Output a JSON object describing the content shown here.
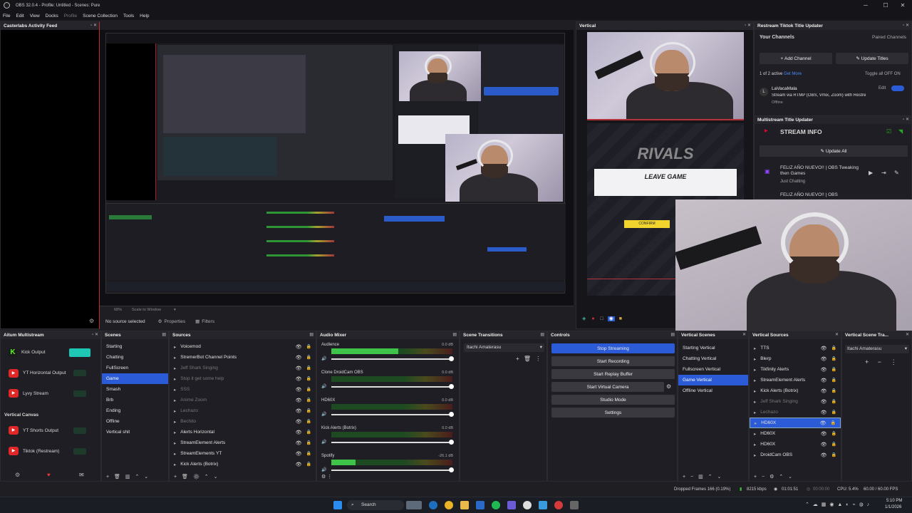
{
  "window": {
    "title": "OBS 32.0.4 - Profile: Untitled - Scenes: Pure"
  },
  "menu": [
    "File",
    "Edit",
    "View",
    "Docks",
    "Profile",
    "Scene Collection",
    "Tools",
    "Help"
  ],
  "activity_feed": {
    "title": "Casterlabs Activity Feed"
  },
  "preview": {
    "zoom": "68%",
    "scale_label": "Scale to Window",
    "no_source": "No source selected",
    "properties": "Properties",
    "filters": "Filters"
  },
  "vertical": {
    "title": "Vertical",
    "game_title": "LEAVE GAME",
    "confirm": "CONFIRM"
  },
  "restream": {
    "title": "Restream Tiktok Title Updater",
    "your_channels": "Your Channels",
    "paired": "Paired Channels",
    "add_channel": "Add Channel",
    "update_titles": "Update Titles",
    "active": "1 of 2 active",
    "get_more": "Get More",
    "toggle_all": "Toggle all",
    "off": "OFF",
    "on": "ON",
    "channel_name": "LaVacaMala",
    "channel_desc": "Stream via RTMP (OBS, Vmix, Zoom) with Restre",
    "channel_status": "Offline",
    "edit": "Edit"
  },
  "multistream_updater": {
    "title": "Multistream Title Updater",
    "stream_info": "STREAM INFO",
    "update_all": "Update All",
    "entry_title": "FELIZ AÑO NUEVO!! | OBS Tweaking then Games",
    "entry_category": "Just Chatting",
    "entry_title_2": "FELIZ AÑO NUEVO!! | OBS"
  },
  "aitum": {
    "title": "Aitum Multistream",
    "outputs": [
      "Kick Output",
      "YT Horizontal Output",
      "Lyvy Stream"
    ],
    "vertical_label": "Vertical Canvas",
    "vertical_outputs": [
      "YT Shorts Output",
      "Tiktok (Restream)"
    ]
  },
  "scenes": {
    "title": "Scenes",
    "items": [
      "Starting",
      "Chatting",
      "FullScreen",
      "Game",
      "Smash",
      "Brb",
      "Ending",
      "Offline",
      "Vertical shit"
    ],
    "selected": "Game"
  },
  "sources": {
    "title": "Sources",
    "items": [
      {
        "name": "Voicemod",
        "dim": false
      },
      {
        "name": "StremerBot Channel Points",
        "dim": false
      },
      {
        "name": "Jeff Shark Singing",
        "dim": true
      },
      {
        "name": "Stop it get some help",
        "dim": true
      },
      {
        "name": "SSS",
        "dim": true
      },
      {
        "name": "Anime Zoom",
        "dim": true
      },
      {
        "name": "Lechazo",
        "dim": true
      },
      {
        "name": "Bechito",
        "dim": true
      },
      {
        "name": "Alerts Horizontal",
        "dim": false
      },
      {
        "name": "StreamElement Alerts",
        "dim": false
      },
      {
        "name": "StreamElements YT",
        "dim": false
      },
      {
        "name": "Kick Alerts (Botrix)",
        "dim": false
      }
    ]
  },
  "mixer": {
    "title": "Audio Mixer",
    "channels": [
      {
        "name": "Audience",
        "db": "0.0 dB",
        "level": 0.55
      },
      {
        "name": "Clone DroidCam OBS",
        "db": "0.0 dB",
        "level": 0.0
      },
      {
        "name": "HD60X",
        "db": "0.0 dB",
        "level": 0.0
      },
      {
        "name": "Kick Alerts (Botrix)",
        "db": "0.0 dB",
        "level": 0.0
      },
      {
        "name": "Spotify",
        "db": "-26.1 dB",
        "level": 0.2
      }
    ]
  },
  "transitions": {
    "title": "Scene Transitions",
    "selected": "Itachi Amaterasu"
  },
  "controls": {
    "title": "Controls",
    "buttons": [
      "Stop Streaming",
      "Start Recording",
      "Start Replay Buffer",
      "Start Virtual Camera",
      "Studio Mode",
      "Settings"
    ]
  },
  "vscenes": {
    "title": "Vertical Scenes",
    "items": [
      "Starting Vertical",
      "Chatting Vertical",
      "Fullscreen Vertical",
      "Game Vertical",
      "Offline Vertical"
    ],
    "selected": "Game Vertical"
  },
  "vsources": {
    "title": "Vertical Sources",
    "items": [
      {
        "name": "TTS",
        "dim": false
      },
      {
        "name": "Blerp",
        "dim": false
      },
      {
        "name": "Tikfinity Alerts",
        "dim": false
      },
      {
        "name": "StreamElement Alerts",
        "dim": false
      },
      {
        "name": "Kick Alerts (Botrix)",
        "dim": false
      },
      {
        "name": "Jeff Shark Singing",
        "dim": true
      },
      {
        "name": "Lechazo",
        "dim": true
      },
      {
        "name": "HD60X",
        "dim": false
      },
      {
        "name": "HD60X",
        "dim": false
      },
      {
        "name": "HD60X",
        "dim": false
      },
      {
        "name": "DroidCam OBS",
        "dim": false
      }
    ],
    "selected_index": 7
  },
  "vtransitions": {
    "title": "Vertical Scene Tra...",
    "selected": "Itachi Amaterasu"
  },
  "status": {
    "dropped": "Dropped Frames 166 (0.19%)",
    "bitrate": "8215 kbps",
    "live_time": "01:01:51",
    "rec_time": "00:00:00",
    "cpu": "CPU: 5.4%",
    "fps": "60.00 / 60.00 FPS"
  },
  "taskbar": {
    "search": "Search",
    "time": "5:10 PM",
    "date": "1/1/2026"
  },
  "colors": {
    "accent": "#2c5bd7",
    "selected": "#2c5bd7",
    "kick": "#53fc18",
    "youtube": "#e02828"
  }
}
